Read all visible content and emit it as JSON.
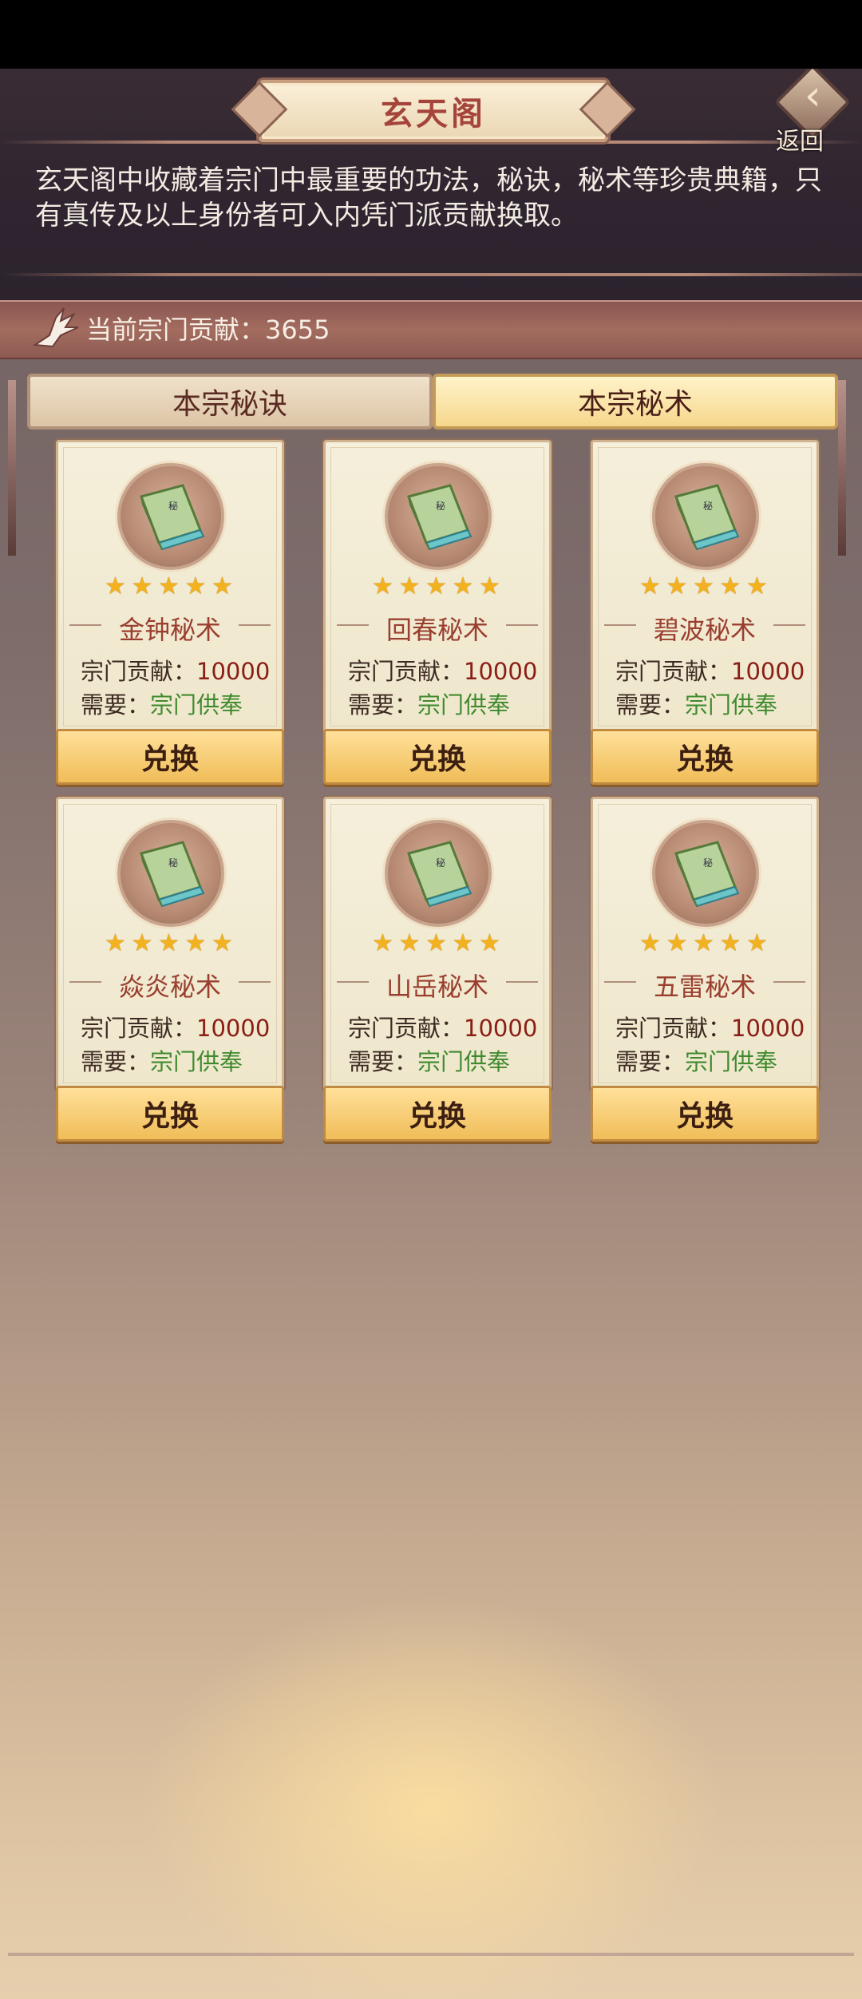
{
  "header": {
    "title": "玄天阁",
    "back_label": "返回",
    "intro": "玄天阁中收藏着宗门中最重要的功法，秘诀，秘术等珍贵典籍，只有真传及以上身份者可入内凭门派贡献换取。"
  },
  "contribution": {
    "label": "当前宗门贡献：",
    "value": "3655"
  },
  "tabs": [
    {
      "label": "本宗秘诀",
      "active": false
    },
    {
      "label": "本宗秘术",
      "active": true
    }
  ],
  "cards": [
    {
      "name": "金钟秘术",
      "stars": 5,
      "cost_label": "宗门贡献：",
      "cost": "10000",
      "req_label": "需要：",
      "req": "宗门供奉",
      "button": "兑换"
    },
    {
      "name": "回春秘术",
      "stars": 5,
      "cost_label": "宗门贡献：",
      "cost": "10000",
      "req_label": "需要：",
      "req": "宗门供奉",
      "button": "兑换"
    },
    {
      "name": "碧波秘术",
      "stars": 5,
      "cost_label": "宗门贡献：",
      "cost": "10000",
      "req_label": "需要：",
      "req": "宗门供奉",
      "button": "兑换"
    },
    {
      "name": "焱炎秘术",
      "stars": 5,
      "cost_label": "宗门贡献：",
      "cost": "10000",
      "req_label": "需要：",
      "req": "宗门供奉",
      "button": "兑换"
    },
    {
      "name": "山岳秘术",
      "stars": 5,
      "cost_label": "宗门贡献：",
      "cost": "10000",
      "req_label": "需要：",
      "req": "宗门供奉",
      "button": "兑换"
    },
    {
      "name": "五雷秘术",
      "stars": 5,
      "cost_label": "宗门贡献：",
      "cost": "10000",
      "req_label": "需要：",
      "req": "宗门供奉",
      "button": "兑换"
    }
  ],
  "icons": {
    "back": "back-arrow-icon",
    "crane": "crane-icon",
    "book": "book-icon",
    "star": "star-icon"
  },
  "colors": {
    "title": "#a5443a",
    "cost_value": "#8a1d14",
    "requirement": "#3f8a2e",
    "star": "#f2b21f"
  }
}
